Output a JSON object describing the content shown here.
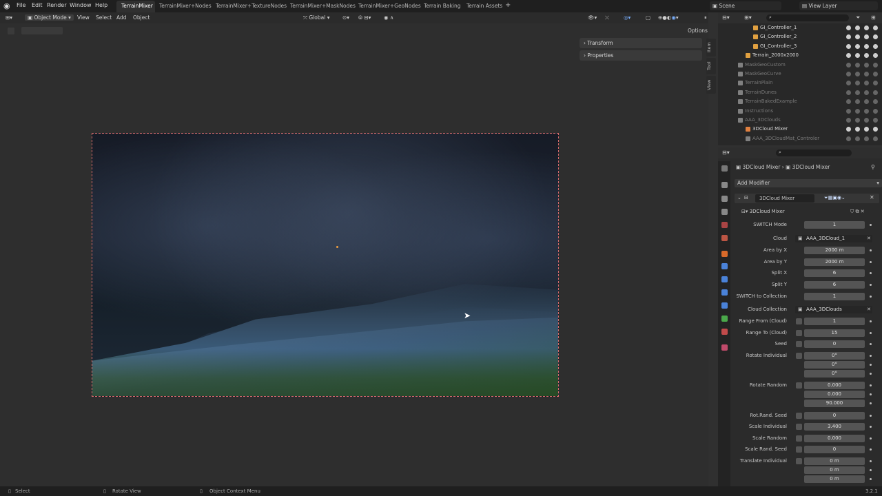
{
  "menu": [
    "File",
    "Edit",
    "Render",
    "Window",
    "Help"
  ],
  "workspaces": [
    {
      "label": "TerrainMixer",
      "active": true
    },
    {
      "label": "TerrainMixer+Nodes"
    },
    {
      "label": "TerrainMixer+TextureNodes"
    },
    {
      "label": "TerrainMixer+MaskNodes"
    },
    {
      "label": "TerrainMixer+GeoNodes"
    },
    {
      "label": "Terrain Baking"
    },
    {
      "label": "Terrain Assets"
    }
  ],
  "add_workspace": "+",
  "scene": "Scene",
  "view_layer": "View Layer",
  "viewport_header": {
    "mode": "Object Mode",
    "menus": [
      "View",
      "Select",
      "Add",
      "Object"
    ],
    "orientation": "Global",
    "options": "Options"
  },
  "npanel": {
    "sections": [
      "Transform",
      "Properties"
    ],
    "tabs": [
      "Item",
      "Tool",
      "View"
    ]
  },
  "outliner": {
    "rows": [
      {
        "name": "GI_Controller_1",
        "color": "#e0a040",
        "indent": 3
      },
      {
        "name": "GI_Controller_2",
        "color": "#e0a040",
        "indent": 3
      },
      {
        "name": "GI_Controller_3",
        "color": "#e0a040",
        "indent": 3
      },
      {
        "name": "Terrain_2000x2000",
        "color": "#e0a040",
        "indent": 2
      },
      {
        "name": "MaskGeoCustom",
        "color": "#808080",
        "indent": 1,
        "dim": true
      },
      {
        "name": "MaskGeoCurve",
        "color": "#808080",
        "indent": 1,
        "dim": true
      },
      {
        "name": "TerrainPlain",
        "color": "#808080",
        "indent": 1,
        "dim": true
      },
      {
        "name": "TerrainDunes",
        "color": "#808080",
        "indent": 1,
        "dim": true
      },
      {
        "name": "TerrainBakedExample",
        "color": "#808080",
        "indent": 1,
        "dim": true
      },
      {
        "name": "Instructions",
        "color": "#808080",
        "indent": 1,
        "dim": true
      },
      {
        "name": "AAA_3DClouds",
        "color": "#808080",
        "indent": 1,
        "dim": true
      },
      {
        "name": "3DCloud Mixer",
        "color": "#e08040",
        "indent": 2
      },
      {
        "name": "AAA_3DCloudMat_Controler",
        "color": "#808080",
        "indent": 2,
        "dim": true
      }
    ]
  },
  "properties": {
    "breadcrumb": [
      "3DCloud Mixer",
      "3DCloud Mixer"
    ],
    "add_modifier": "Add Modifier",
    "modifier_name": "3DCloud Mixer",
    "node_group": "3DCloud Mixer",
    "fields": [
      {
        "label": "SWITCH Mode",
        "value": "1"
      },
      {
        "label": "Cloud",
        "value": "AAA_3DCloud_1",
        "kind": "object"
      },
      {
        "label": "Area by X",
        "value": "2000 m"
      },
      {
        "label": "Area by Y",
        "value": "2000 m"
      },
      {
        "label": "Split X",
        "value": "6"
      },
      {
        "label": "Split Y",
        "value": "6"
      },
      {
        "label": "SWITCH to Collection",
        "value": "1"
      },
      {
        "label": "Cloud Collection",
        "value": "AAA_3DClouds",
        "kind": "collection"
      },
      {
        "label": "Range From (Cloud)",
        "value": "1",
        "kind": "attr"
      },
      {
        "label": "Range To (Cloud)",
        "value": "15",
        "kind": "attr"
      },
      {
        "label": "Seed",
        "value": "0",
        "kind": "attr"
      },
      {
        "label": "Rotate Individual",
        "value": "0°",
        "kind": "attr"
      },
      {
        "label": "",
        "value": "0°"
      },
      {
        "label": "",
        "value": "0°"
      },
      {
        "label": "Rotate Random",
        "value": "0.000",
        "kind": "attr"
      },
      {
        "label": "",
        "value": "0.000"
      },
      {
        "label": "",
        "value": "90.000"
      },
      {
        "label": "Rot.Rand. Seed",
        "value": "0",
        "kind": "attr"
      },
      {
        "label": "Scale Individual",
        "value": "3.400",
        "kind": "attr"
      },
      {
        "label": "Scale Random",
        "value": "0.000",
        "kind": "attr"
      },
      {
        "label": "Scale Rand. Seed",
        "value": "0",
        "kind": "attr"
      },
      {
        "label": "Translate Individual",
        "value": "0 m",
        "kind": "attr"
      },
      {
        "label": "",
        "value": "0 m"
      },
      {
        "label": "",
        "value": "0 m"
      }
    ]
  },
  "statusbar": {
    "items": [
      "Select",
      "Rotate View",
      "Object Context Menu"
    ],
    "version": "3.2.1"
  }
}
